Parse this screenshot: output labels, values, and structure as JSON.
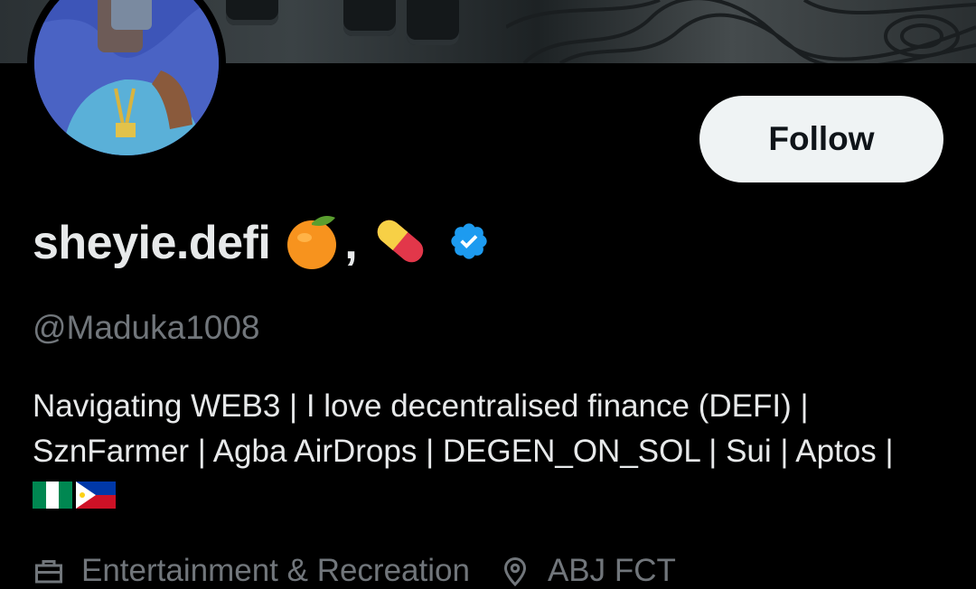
{
  "profile": {
    "display_name": "sheyie.defi",
    "name_emojis": [
      "tangerine-emoji",
      "pill-emoji"
    ],
    "name_separator": ",",
    "verified": true,
    "handle": "@Maduka1008",
    "follow_label": "Follow",
    "bio_line1": "Navigating WEB3 | I love decentralised finance (DEFI) |",
    "bio_line2": "SznFarmer | Agba AirDrops | DEGEN_ON_SOL | Sui | Aptos |",
    "bio_flags": [
      "nigeria-flag",
      "philippines-flag"
    ],
    "category": "Entertainment & Recreation",
    "location": "ABJ FCT"
  },
  "colors": {
    "background": "#000000",
    "primary_text": "#e7e9ea",
    "secondary_text": "#71767b",
    "verified_blue": "#1d9bf0",
    "follow_bg": "#eff3f4"
  }
}
